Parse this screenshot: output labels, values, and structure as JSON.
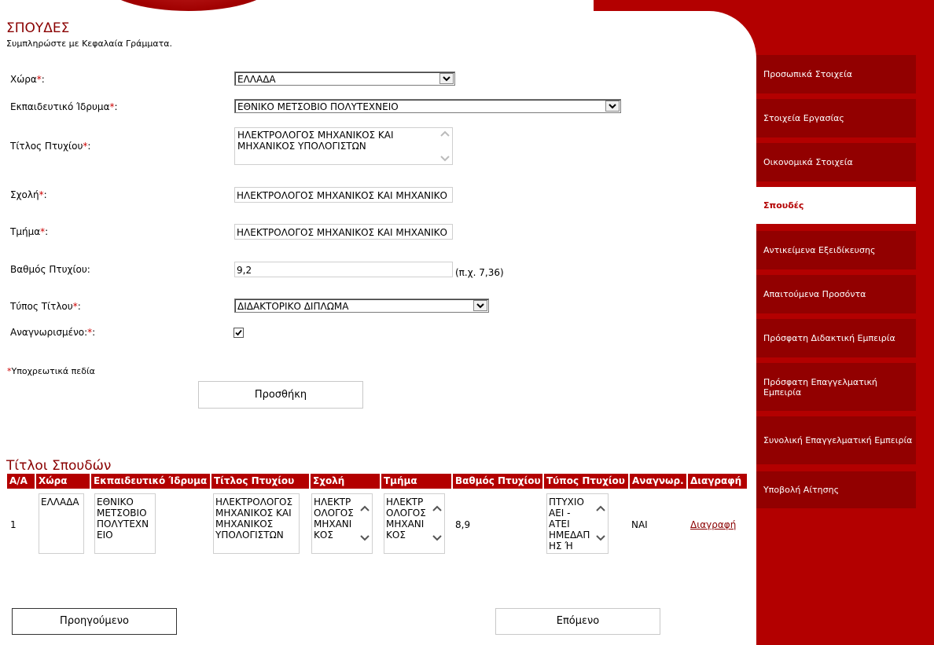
{
  "header": {
    "title": "ΣΠΟΥΔΕΣ",
    "subtitle": "Συμπληρώστε με Κεφαλαία Γράμματα."
  },
  "form": {
    "country_label": "Χώρα",
    "country_value": "ΕΛΛΑΔΑ",
    "institution_label": "Εκπαιδευτικό Ίδρυμα",
    "institution_value": "ΕΘΝΙΚΟ ΜΕΤΣΟΒΙΟ ΠΟΛΥΤΕΧΝΕΙΟ",
    "degree_title_label": "Τίτλος Πτυχίου",
    "degree_title_value": "ΗΛΕΚΤΡΟΛΟΓΟΣ ΜΗΧΑΝΙΚΟΣ ΚΑΙ ΜΗΧΑΝΙΚΟΣ ΥΠΟΛΟΓΙΣΤΩΝ",
    "school_label": "Σχολή",
    "school_value": "ΗΛΕΚΤΡΟΛΟΓΟΣ ΜΗΧΑΝΙΚΟΣ ΚΑΙ ΜΗΧΑΝΙΚΟ",
    "department_label": "Τμήμα",
    "department_value": "ΗΛΕΚΤΡΟΛΟΓΟΣ ΜΗΧΑΝΙΚΟΣ ΚΑΙ ΜΗΧΑΝΙΚΟ",
    "grade_label": "Βαθμός Πτυχίου:",
    "grade_value": "9,2",
    "grade_hint": "(π.χ. 7,36)",
    "title_type_label": "Τύπος Τίτλου",
    "title_type_value": "ΔΙΔΑΚΤΟΡΙΚΟ ΔΙΠΛΩΜΑ",
    "recognized_label": "Αναγνωρισμένο:",
    "recognized_checked": true,
    "required_star": "*",
    "colon": ":",
    "required_note": "Υποχρεωτικά πεδία",
    "add_button": "Προσθήκη"
  },
  "table": {
    "title": "Τίτλοι Σπουδών",
    "headers": [
      "Α/Α",
      "Χώρα",
      "Εκπαιδευτικό Ίδρυμα",
      "Τίτλος Πτυχίου",
      "Σχολή",
      "Τμήμα",
      "Βαθμός Πτυχίου",
      "Τύπος Πτυχίου",
      "Αναγνωρ.",
      "Διαγραφή"
    ],
    "rows": [
      {
        "index": "1",
        "country": "ΕΛΛΑΔΑ",
        "institution": "ΕΘΝΙΚΟ ΜΕΤΣΟΒΙΟ ΠΟΛΥΤΕΧΝ ΕΙΟ",
        "degree_title": "ΗΛΕΚΤΡΟΛΟΓΟΣ ΜΗΧΑΝΙΚΟΣ ΚΑΙ ΜΗΧΑΝΙΚΟΣ ΥΠΟΛΟΓΙΣΤΩΝ",
        "school": "ΗΛΕΚΤΡ ΟΛΟΓΟΣ ΜΗΧΑΝΙ ΚΟΣ",
        "department": "ΗΛΕΚΤΡ ΟΛΟΓΟΣ ΜΗΧΑΝΙ ΚΟΣ",
        "grade": "8,9",
        "degree_type": "ΠΤΥΧΙΟ ΑΕΙ - ΑΤΕΙ ΗΜΕΔΑΠ ΗΣ Ή",
        "recognized": "ΝΑΙ",
        "delete": "Διαγραφή"
      }
    ]
  },
  "nav": {
    "previous": "Προηγούμενο",
    "next": "Επόμενο"
  },
  "sidebar": {
    "items": [
      {
        "label": "Προσωπικά Στοιχεία",
        "active": false
      },
      {
        "label": "Στοιχεία Εργασίας",
        "active": false
      },
      {
        "label": "Οικονομικά Στοιχεία",
        "active": false
      },
      {
        "label": "Σπουδές",
        "active": true
      },
      {
        "label": "Αντικείμενα Εξειδίκευσης",
        "active": false
      },
      {
        "label": "Απαιτούμενα Προσόντα",
        "active": false
      },
      {
        "label": "Πρόσφατη Διδακτική Εμπειρία",
        "active": false
      },
      {
        "label": "Πρόσφατη Επαγγελματική Εμπειρία",
        "active": false
      },
      {
        "label": "Συνολική Επαγγελματική Εμπειρία",
        "active": false
      },
      {
        "label": "Υποβολή Αίτησης",
        "active": false
      }
    ]
  },
  "colors": {
    "accent": "#b30000",
    "sidebar_item": "#920000",
    "title": "#8a0000"
  }
}
